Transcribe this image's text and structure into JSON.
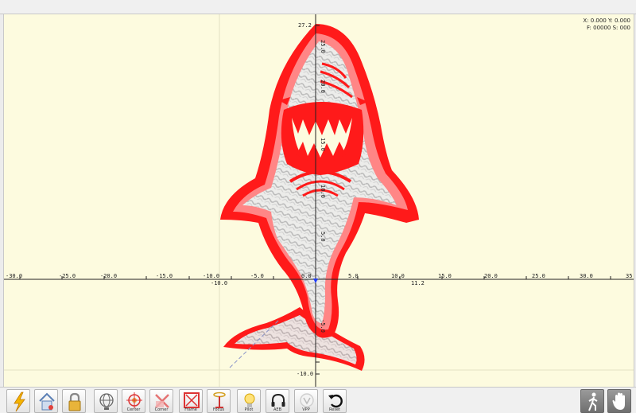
{
  "readout": {
    "xy": "X: 0.000 Y: 0.000",
    "fs": "F: 00000 S: 000"
  },
  "axis": {
    "x_ticks": [
      "-30.0",
      "-25.0",
      "-20.0",
      "-15.0",
      "-10.0",
      "-5.0",
      "0.0",
      "5.0",
      "10.0",
      "15.0",
      "20.0",
      "25.0",
      "30.0",
      "35"
    ],
    "y_ticks": [
      "27.2",
      "25.0",
      "20.0",
      "15.0",
      "10.0",
      "5.0",
      "-5.0",
      "-10.0"
    ],
    "x_extent_min": "-10.0",
    "x_extent_max": "11.2",
    "y_extent_min": "-10.0"
  },
  "toolbar": {
    "buttons": [
      {
        "name": "lightning-button",
        "label": ""
      },
      {
        "name": "home-button",
        "label": ""
      },
      {
        "name": "lock-button",
        "label": ""
      },
      {
        "name": "globe-button",
        "label": ""
      },
      {
        "name": "center-button",
        "label": "Center"
      },
      {
        "name": "corner-button",
        "label": "Corner"
      },
      {
        "name": "frame-button",
        "label": "Frame"
      },
      {
        "name": "focus-button",
        "label": "Focus"
      },
      {
        "name": "pilot-button",
        "label": "Pilot"
      },
      {
        "name": "aeb-button",
        "label": "AEB"
      },
      {
        "name": "vpp-button",
        "label": "VPP"
      },
      {
        "name": "reset-button",
        "label": "Reset"
      }
    ],
    "right_buttons": [
      {
        "name": "walk-button"
      },
      {
        "name": "stop-hand-button"
      }
    ]
  },
  "colors": {
    "shark": "#ff1a1a",
    "shark_light": "#ff7a7a",
    "canvas": "#fdfbdf",
    "scan": "#d7d7d7"
  }
}
